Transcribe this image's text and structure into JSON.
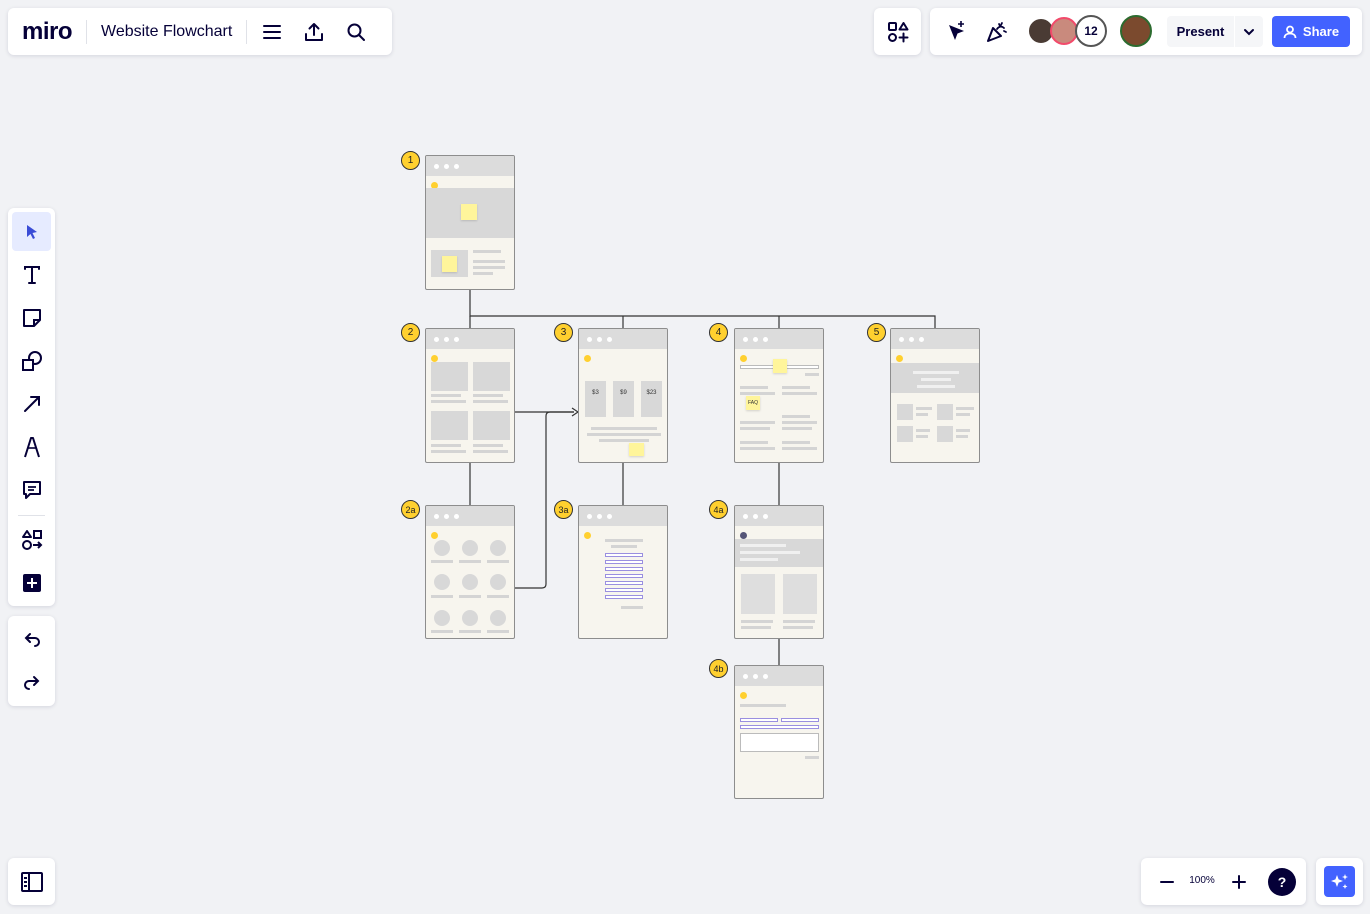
{
  "app": {
    "logo": "miro",
    "board_title": "Website Flowchart"
  },
  "collaborators": {
    "count_label": "12"
  },
  "toolbar_right": {
    "present_label": "Present",
    "share_label": "Share"
  },
  "zoom": {
    "level_label": "100%"
  },
  "help": {
    "label": "?"
  },
  "board": {
    "frames": [
      {
        "id": "1",
        "badge": "1"
      },
      {
        "id": "2",
        "badge": "2"
      },
      {
        "id": "3",
        "badge": "3"
      },
      {
        "id": "4",
        "badge": "4"
      },
      {
        "id": "5",
        "badge": "5"
      },
      {
        "id": "2a",
        "badge": "2a"
      },
      {
        "id": "3a",
        "badge": "3a"
      },
      {
        "id": "4a",
        "badge": "4a"
      },
      {
        "id": "4b",
        "badge": "4b"
      }
    ],
    "pricing": [
      "$3",
      "$9",
      "$23"
    ],
    "faq_label": "FAQ"
  },
  "colors": {
    "accent": "#4262ff",
    "sticky": "#fff59b",
    "badge": "#ffd02f"
  }
}
